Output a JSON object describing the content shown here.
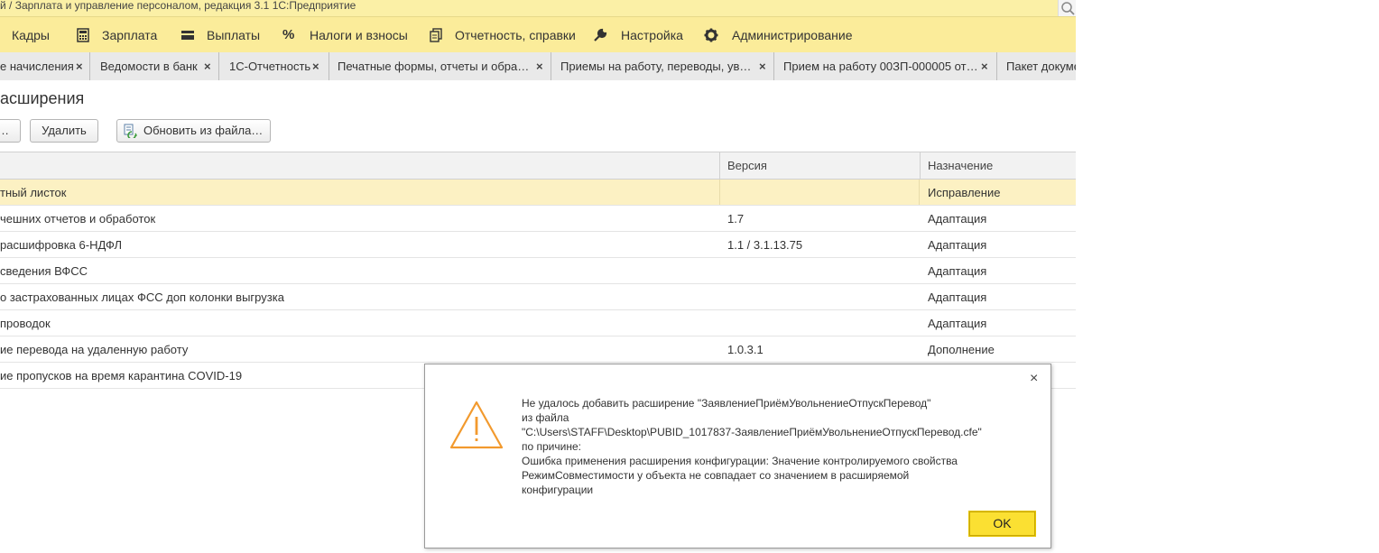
{
  "window": {
    "title": "й / Зарплата и управление персоналом, редакция 3.1 1С:Предприятие"
  },
  "sections": [
    {
      "label": "Кадры",
      "icon": "people-icon"
    },
    {
      "label": "Зарплата",
      "icon": "calculator-icon"
    },
    {
      "label": "Выплаты",
      "icon": "wallet-icon"
    },
    {
      "label": "Налоги и взносы",
      "icon": "percent-icon"
    },
    {
      "label": "Отчетность, справки",
      "icon": "documents-icon"
    },
    {
      "label": "Настройка",
      "icon": "wrench-icon"
    },
    {
      "label": "Администрирование",
      "icon": "gear-icon"
    }
  ],
  "tabs": [
    {
      "label": "е начисления",
      "close": "×"
    },
    {
      "label": "Ведомости в банк",
      "close": "×"
    },
    {
      "label": "1С-Отчетность",
      "close": "×"
    },
    {
      "label": "Печатные формы, отчеты и обра…",
      "close": "×"
    },
    {
      "label": "Приемы на работу, переводы, ув…",
      "close": "×"
    },
    {
      "label": "Прием на работу 00ЗП-000005 от…",
      "close": "×"
    },
    {
      "label": "Пакет докуме",
      "close": ""
    }
  ],
  "form": {
    "title": "асширения",
    "buttons": {
      "partial": "…",
      "delete": "Удалить",
      "update_from_file": "Обновить из файла…"
    }
  },
  "table": {
    "columns": [
      "",
      "Версия",
      "Назначение"
    ],
    "rows": [
      {
        "name": "тный листок",
        "version": "",
        "purpose": "Исправление"
      },
      {
        "name": "чешних отчетов и обработок",
        "version": "1.7",
        "purpose": "Адаптация"
      },
      {
        "name": " расшифровка 6-НДФЛ",
        "version": "1.1 / 3.1.13.75",
        "purpose": "Адаптация"
      },
      {
        "name": " сведения ВФСС",
        "version": "",
        "purpose": "Адаптация"
      },
      {
        "name": "о застрахованных лицах ФСС доп колонки выгрузка",
        "version": "",
        "purpose": "Адаптация"
      },
      {
        "name": "проводок",
        "version": "",
        "purpose": "Адаптация"
      },
      {
        "name": "ие перевода на удаленную работу",
        "version": "1.0.3.1",
        "purpose": "Дополнение"
      },
      {
        "name": "ие пропусков на время карантина COVID-19",
        "version": "",
        "purpose": ""
      }
    ]
  },
  "dialog": {
    "close": "×",
    "lines": [
      "Не удалось добавить расширение \"ЗаявлениеПриёмУвольнениеОтпускПеревод\"",
      "из файла",
      "\"C:\\Users\\STAFF\\Desktop\\PUBID_1017837-ЗаявлениеПриёмУвольнениеОтпускПеревод.cfe\"",
      "по причине:",
      "Ошибка применения расширения конфигурации: Значение контролируемого свойства",
      "РежимСовместимости у объекта  не совпадает со значением в расширяемой",
      "конфигурации"
    ],
    "ok_label": "OK",
    "warning_color": "#f29a2e"
  },
  "colors": {
    "titlebar": "#fbf0a6",
    "sections_bar": "#fbec9a",
    "selected_row": "#fcf1c3",
    "ok_button": "#fbe032"
  }
}
